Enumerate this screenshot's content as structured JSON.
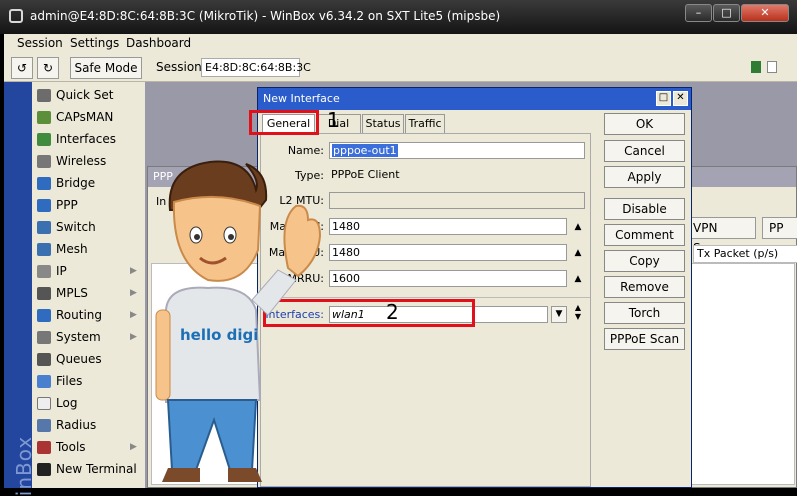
{
  "window": {
    "title": "admin@E4:8D:8C:64:8B:3C (MikroTik) - WinBox v6.34.2 on SXT Lite5 (mipsbe)"
  },
  "menu": [
    "Session",
    "Settings",
    "Dashboard"
  ],
  "toolbar": {
    "undo_icon": "undo-icon",
    "redo_icon": "redo-icon",
    "safe_mode": "Safe Mode",
    "session_label": "Session:",
    "session_value": "E4:8D:8C:64:8B:3C"
  },
  "sidebar": {
    "vertical_label": "inBox",
    "items": [
      {
        "label": "Quick Set",
        "icon": "wand-icon",
        "color": "#6c6c6c"
      },
      {
        "label": "CAPsMAN",
        "icon": "antenna-icon",
        "color": "#5b8f3a"
      },
      {
        "label": "Interfaces",
        "icon": "interfaces-icon",
        "color": "#3f8c3f"
      },
      {
        "label": "Wireless",
        "icon": "wireless-icon",
        "color": "#777777"
      },
      {
        "label": "Bridge",
        "icon": "bridge-icon",
        "color": "#2f6cc0"
      },
      {
        "label": "PPP",
        "icon": "ppp-icon",
        "color": "#2f6cc0"
      },
      {
        "label": "Switch",
        "icon": "switch-icon",
        "color": "#3a6fb0"
      },
      {
        "label": "Mesh",
        "icon": "mesh-icon",
        "color": "#3a6fb0"
      },
      {
        "label": "IP",
        "icon": "ip-icon",
        "color": "#888888",
        "sub": true
      },
      {
        "label": "MPLS",
        "icon": "mpls-icon",
        "color": "#555555",
        "sub": true
      },
      {
        "label": "Routing",
        "icon": "routing-icon",
        "color": "#2f6cc0",
        "sub": true
      },
      {
        "label": "System",
        "icon": "gear-icon",
        "color": "#777777",
        "sub": true
      },
      {
        "label": "Queues",
        "icon": "queues-icon",
        "color": "#555555"
      },
      {
        "label": "Files",
        "icon": "folder-icon",
        "color": "#4a7fd0"
      },
      {
        "label": "Log",
        "icon": "log-icon",
        "color": "#eeeeee"
      },
      {
        "label": "Radius",
        "icon": "radius-icon",
        "color": "#5577aa"
      },
      {
        "label": "Tools",
        "icon": "tools-icon",
        "color": "#aa3333",
        "sub": true
      },
      {
        "label": "New Terminal",
        "icon": "terminal-icon",
        "color": "#222222"
      }
    ]
  },
  "ppp_window": {
    "title": "PPP",
    "vpn_server": "VPN Server",
    "ppp_more": "PP",
    "col_tx_packet": "Tx Packet (p/s)",
    "col_in": "In"
  },
  "dialog": {
    "title": "New Interface",
    "tabs": [
      "General",
      "Dial Out",
      "Status",
      "Traffic"
    ],
    "fields": {
      "name_label": "Name:",
      "name_value": "pppoe-out1",
      "type_label": "Type:",
      "type_value": "PPPoE Client",
      "l2mtu_label": "L2 MTU:",
      "l2mtu_value": "",
      "max_mtu_label": "Max MTU:",
      "max_mtu_value": "1480",
      "max_mru_label": "Max MRU:",
      "max_mru_value": "1480",
      "mrru_label": "MRRU:",
      "mrru_value": "1600",
      "interfaces_label": "Interfaces:",
      "interfaces_value": "wlan1"
    },
    "buttons": [
      "OK",
      "Cancel",
      "Apply",
      "Disable",
      "Comment",
      "Copy",
      "Remove",
      "Torch",
      "PPPoE Scan"
    ]
  },
  "annotations": {
    "num1": "1",
    "num2": "2",
    "mascot_shirt": "hello digi"
  },
  "colors": {
    "accent": "#2a5dcb",
    "highlight": "#e0111a"
  }
}
